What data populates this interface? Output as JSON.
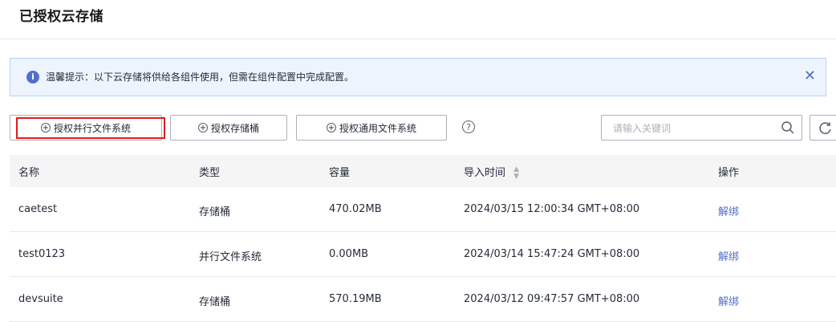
{
  "page": {
    "title": "已授权云存储"
  },
  "notice": {
    "icon": "info-icon",
    "text": "温馨提示：以下云存储将供给各组件使用，但需在组件配置中完成配置。",
    "close_icon": "close-icon"
  },
  "toolbar": {
    "buttons": [
      {
        "label": "授权并行文件系统",
        "icon": "plus-circle-icon"
      },
      {
        "label": "授权存储桶",
        "icon": "plus-circle-icon"
      },
      {
        "label": "授权通用文件系统",
        "icon": "plus-circle-icon"
      }
    ],
    "help_icon": "question-circle-icon",
    "search": {
      "placeholder": "请输入关键词",
      "value": "",
      "icon": "search-icon"
    },
    "refresh_icon": "refresh-icon",
    "highlight_color": "#e01e1e"
  },
  "table": {
    "columns": [
      "名称",
      "类型",
      "容量",
      "导入时间",
      "操作"
    ],
    "sort_icon": "sort-icon",
    "rows": [
      {
        "name": "caetest",
        "type": "存储桶",
        "capacity": "470.02MB",
        "time": "2024/03/15 12:00:34 GMT+08:00",
        "action": "解绑"
      },
      {
        "name": "test0123",
        "type": "并行文件系统",
        "capacity": "0.00MB",
        "time": "2024/03/14 15:47:24 GMT+08:00",
        "action": "解绑"
      },
      {
        "name": "devsuite",
        "type": "存储桶",
        "capacity": "570.19MB",
        "time": "2024/03/12 09:47:57 GMT+08:00",
        "action": "解绑"
      }
    ]
  },
  "colors": {
    "link": "#526ecc",
    "notice_bg": "#eef4fe",
    "header_bg": "#f5f5f5"
  }
}
